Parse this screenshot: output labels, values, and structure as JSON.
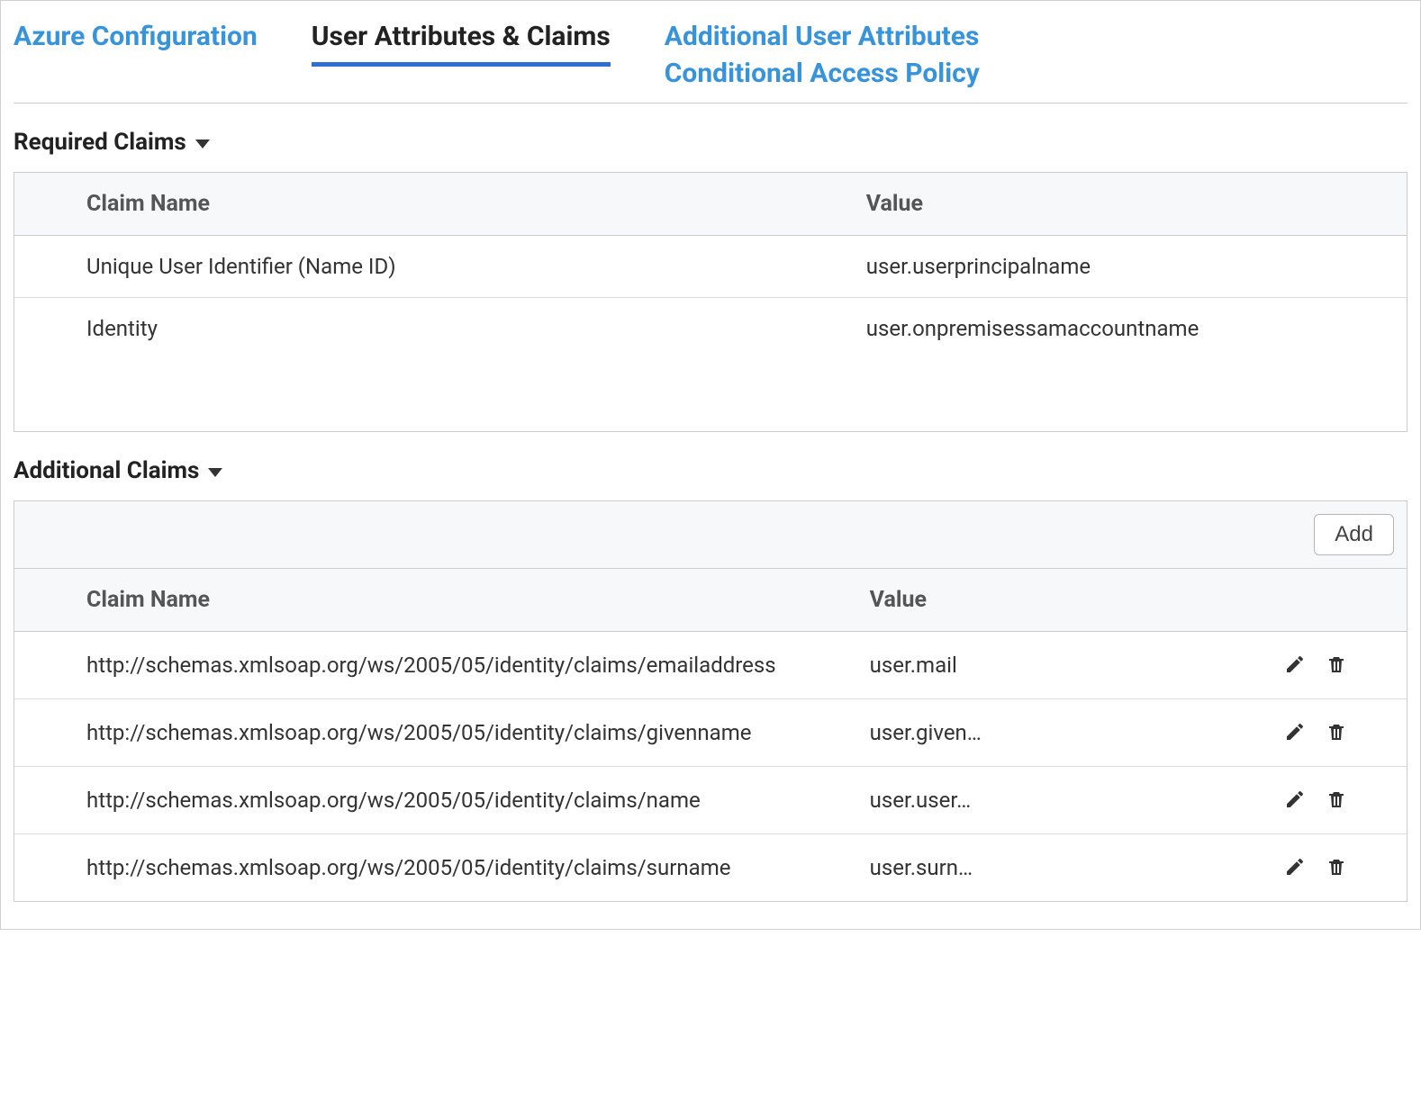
{
  "tabs": {
    "azure": "Azure Configuration",
    "claims": "User Attributes & Claims",
    "additional_attrs": "Additional User Attributes",
    "conditional": "Conditional Access Policy"
  },
  "sections": {
    "required": "Required Claims",
    "additional": "Additional Claims"
  },
  "headers": {
    "claim_name": "Claim Name",
    "value": "Value"
  },
  "add_label": "Add",
  "required_claims": [
    {
      "name": "Unique User Identifier (Name ID)",
      "value": "user.userprincipalname"
    },
    {
      "name": "Identity",
      "value": "user.onpremisessamaccountname"
    }
  ],
  "additional_claims": [
    {
      "name": "http://schemas.xmlsoap.org/ws/2005/05/identity/claims/emailaddress",
      "value": "user.mail"
    },
    {
      "name": "http://schemas.xmlsoap.org/ws/2005/05/identity/claims/givenname",
      "value": "user.given…"
    },
    {
      "name": "http://schemas.xmlsoap.org/ws/2005/05/identity/claims/name",
      "value": "user.user…"
    },
    {
      "name": "http://schemas.xmlsoap.org/ws/2005/05/identity/claims/surname",
      "value": "user.surn…"
    }
  ]
}
